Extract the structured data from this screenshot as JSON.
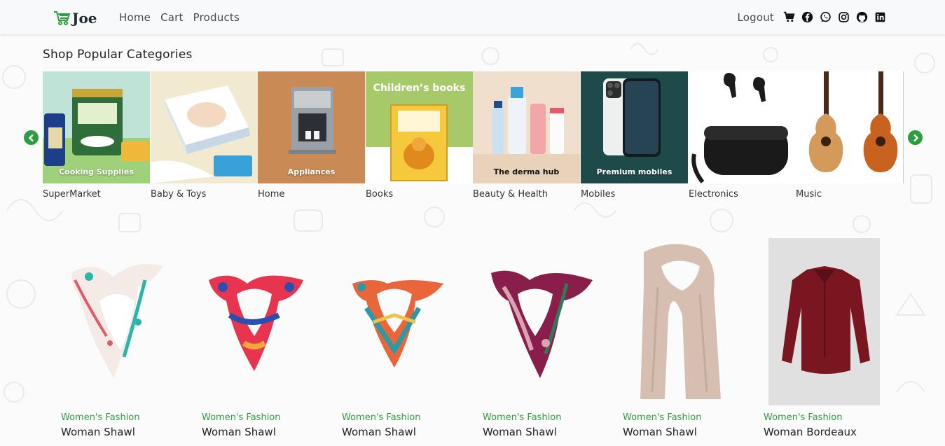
{
  "nav": {
    "brand_name": "Joe",
    "links": [
      "Home",
      "Cart",
      "Products"
    ],
    "logout_label": "Logout",
    "social_icons": [
      "cart-icon",
      "facebook-icon",
      "whatsapp-icon",
      "instagram-icon",
      "github-icon",
      "linkedin-icon"
    ]
  },
  "categories_section": {
    "title": "Shop Popular Categories",
    "items": [
      {
        "label": "SuperMarket",
        "caption": "Cooking Supplies"
      },
      {
        "label": "Baby & Toys",
        "caption": ""
      },
      {
        "label": "Home",
        "caption": "Appliances"
      },
      {
        "label": "Books",
        "caption": "Children’s books"
      },
      {
        "label": "Beauty & Health",
        "caption": "The derma hub"
      },
      {
        "label": "Mobiles",
        "caption": "Premium mobiles"
      },
      {
        "label": "Electronics",
        "caption": ""
      },
      {
        "label": "Music",
        "caption": ""
      }
    ]
  },
  "products": [
    {
      "category": "Women's Fashion",
      "title": "Woman Shawl"
    },
    {
      "category": "Women's Fashion",
      "title": "Woman Shawl"
    },
    {
      "category": "Women's Fashion",
      "title": "Woman Shawl"
    },
    {
      "category": "Women's Fashion",
      "title": "Woman Shawl"
    },
    {
      "category": "Women's Fashion",
      "title": "Woman Shawl"
    },
    {
      "category": "Women's Fashion",
      "title": "Woman Bordeaux"
    }
  ],
  "colors": {
    "accent_green": "#2e9d3e",
    "navbar_bg": "#f8f9fa"
  }
}
